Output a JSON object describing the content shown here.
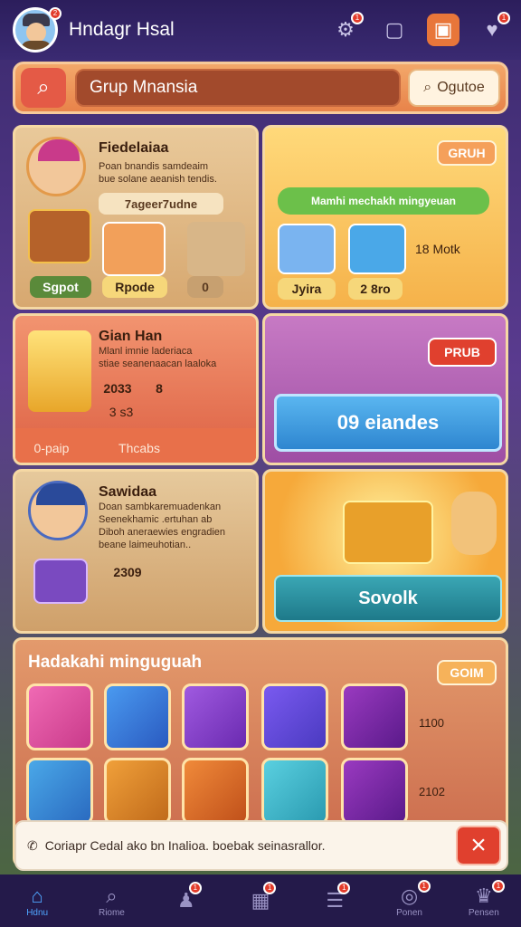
{
  "header": {
    "title": "Hndagr Hsal",
    "avatar_badge": "2",
    "icons": [
      {
        "name": "controller-icon",
        "glyph": "🎮",
        "badge": "1"
      },
      {
        "name": "book-icon",
        "glyph": "▢",
        "badge": ""
      },
      {
        "name": "shop-icon",
        "glyph": "▣",
        "badge": ""
      },
      {
        "name": "heart-icon",
        "glyph": "♥",
        "badge": "1"
      }
    ]
  },
  "search": {
    "placeholder": "Grup Mnansia",
    "filter_label": "Ogutoe"
  },
  "cards": {
    "c1": {
      "title": "Fiedelaiaa",
      "desc": "Poan bnandis samdeaim\nbue solane aeanish tendis.",
      "stat": "7ageer7udne",
      "btn1": "Sgpot",
      "btn2": "Rpode",
      "btn3": "0"
    },
    "c2": {
      "badge": "GRUH",
      "banner": "Mamhi mechakh mingyeuan",
      "stat": "18 Motk",
      "btn1": "Jyira",
      "btn2": "2 8ro"
    },
    "c3": {
      "title": "Gian Han",
      "desc": "Mlanl imnie laderiaca\nstiae seanenaacan laaloka",
      "stat1": "2033",
      "stat1b": "8",
      "stat2": "3 s3",
      "foot1": "0-paip",
      "foot2": "Thcabs"
    },
    "c4": {
      "badge": "PRUB",
      "button": "09 eiandes"
    },
    "c5": {
      "title": "Sawidaa",
      "desc": "Doan sambkaremuadenkan\nSeenekhamic .ertuhan ab\nDiboh aneraewies engradien\nbeane laimeuhotian..",
      "stat": "2309"
    },
    "c6": {
      "button": "Sovolk"
    },
    "c7": {
      "title": "Hadakahi minguguah",
      "badge": "GOIM",
      "row1_label": "1100",
      "row2_label": "2102"
    }
  },
  "toast": {
    "message": "Coriapr Cedal ako bn Inalioa. boebak seinasrallor.",
    "close": "×"
  },
  "nav": [
    {
      "label": "Hdnu",
      "glyph": "⌂",
      "badge": ""
    },
    {
      "label": "Riome",
      "glyph": "⌕",
      "badge": ""
    },
    {
      "label": "",
      "glyph": "♟",
      "badge": "1"
    },
    {
      "label": "",
      "glyph": "▦",
      "badge": "1"
    },
    {
      "label": "",
      "glyph": "☰",
      "badge": "1"
    },
    {
      "label": "Ponen",
      "glyph": "◎",
      "badge": "1"
    },
    {
      "label": "Pensen",
      "glyph": "♛",
      "badge": "1"
    }
  ]
}
